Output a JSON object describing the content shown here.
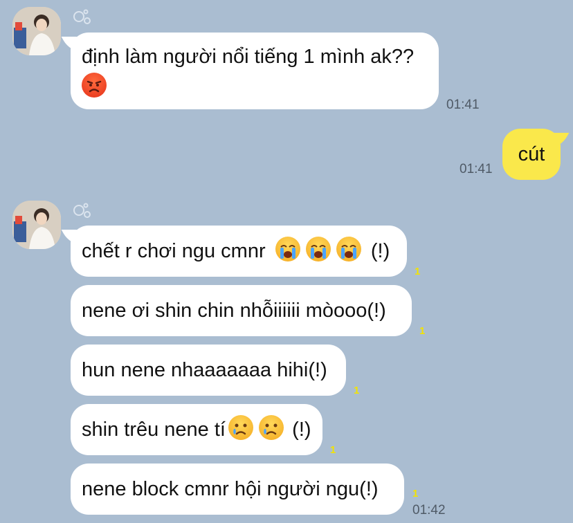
{
  "chat": {
    "messages": [
      {
        "text": "định làm người nổi tiếng 1 mình ak??",
        "emoji": "angry-face-icon",
        "time": "01:41"
      },
      {
        "text": "cút",
        "time": "01:41"
      },
      {
        "text": "chết r chơi ngu cmnr",
        "suffix": "(!)",
        "emoji": "loudly-crying-face-icon",
        "read": "1"
      },
      {
        "text": "nene ơi shin chin nhỗiiiiii mòooo(!)",
        "read": "1"
      },
      {
        "text": "hun nene nhaaaaaaa hihi(!)",
        "read": "1"
      },
      {
        "text": "shin trêu nene tí",
        "suffix": "(!)",
        "emoji": "crying-face-icon",
        "read": "1"
      },
      {
        "text": "nene block cmnr hội người ngu(!)",
        "read": "1",
        "time": "01:42"
      }
    ]
  },
  "colors": {
    "background": "#aabdd1",
    "incoming": "#ffffff",
    "outgoing": "#fae84b",
    "read_indicator": "#f3e300"
  }
}
